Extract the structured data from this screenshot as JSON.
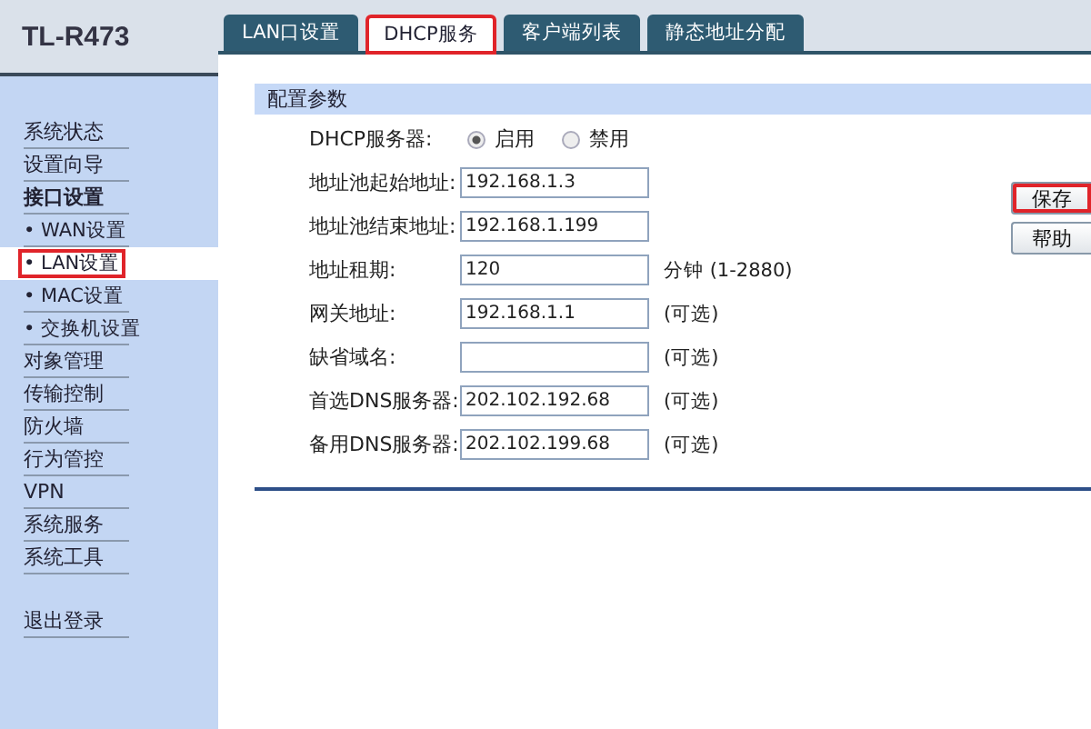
{
  "logo": "TL-R473",
  "tabs": [
    {
      "label": "LAN口设置",
      "selected": false,
      "annotated": false
    },
    {
      "label": "DHCP服务",
      "selected": true,
      "annotated": true
    },
    {
      "label": "客户端列表",
      "selected": false,
      "annotated": false
    },
    {
      "label": "静态地址分配",
      "selected": false,
      "annotated": false
    }
  ],
  "sidebar": {
    "items": [
      {
        "label": "系统状态",
        "kind": "item",
        "selected": false,
        "annotated": false
      },
      {
        "label": "设置向导",
        "kind": "item",
        "selected": false,
        "annotated": false
      },
      {
        "label": "接口设置",
        "kind": "section",
        "selected": false,
        "annotated": false
      },
      {
        "label": "• WAN设置",
        "kind": "sub",
        "selected": false,
        "annotated": false
      },
      {
        "label": "• LAN设置",
        "kind": "sub",
        "selected": true,
        "annotated": true
      },
      {
        "label": "• MAC设置",
        "kind": "sub",
        "selected": false,
        "annotated": false
      },
      {
        "label": "• 交换机设置",
        "kind": "sub",
        "selected": false,
        "annotated": false
      },
      {
        "label": "对象管理",
        "kind": "item",
        "selected": false,
        "annotated": false
      },
      {
        "label": "传输控制",
        "kind": "item",
        "selected": false,
        "annotated": false
      },
      {
        "label": "防火墙",
        "kind": "item",
        "selected": false,
        "annotated": false
      },
      {
        "label": "行为管控",
        "kind": "item",
        "selected": false,
        "annotated": false
      },
      {
        "label": "VPN",
        "kind": "item",
        "selected": false,
        "annotated": false
      },
      {
        "label": "系统服务",
        "kind": "item",
        "selected": false,
        "annotated": false
      },
      {
        "label": "系统工具",
        "kind": "item",
        "selected": false,
        "annotated": false
      },
      {
        "label": "退出登录",
        "kind": "logout",
        "selected": false,
        "annotated": false
      }
    ]
  },
  "panel": {
    "title": "配置参数",
    "rows": [
      {
        "kind": "radio",
        "label": "DHCP服务器:",
        "options": [
          {
            "label": "启用",
            "selected": true
          },
          {
            "label": "禁用",
            "selected": false
          }
        ]
      },
      {
        "kind": "field",
        "label": "地址池起始地址:",
        "value": "192.168.1.3"
      },
      {
        "kind": "field",
        "label": "地址池结束地址:",
        "value": "192.168.1.199"
      },
      {
        "kind": "field",
        "label": "地址租期:",
        "value": "120",
        "hint": "分钟 (1-2880)"
      },
      {
        "kind": "field",
        "label": "网关地址:",
        "value": "192.168.1.1",
        "hint": "(可选)"
      },
      {
        "kind": "field",
        "label": "缺省域名:",
        "hint": "(可选)"
      },
      {
        "kind": "field",
        "label": "首选DNS服务器:",
        "value": "202.102.192.68",
        "hint": "(可选)"
      },
      {
        "kind": "field",
        "label": "备用DNS服务器:",
        "value": "202.102.199.68",
        "hint": "(可选)"
      }
    ]
  },
  "buttons": [
    {
      "label": "保存",
      "annotated": true
    },
    {
      "label": "帮助",
      "annotated": false
    }
  ]
}
